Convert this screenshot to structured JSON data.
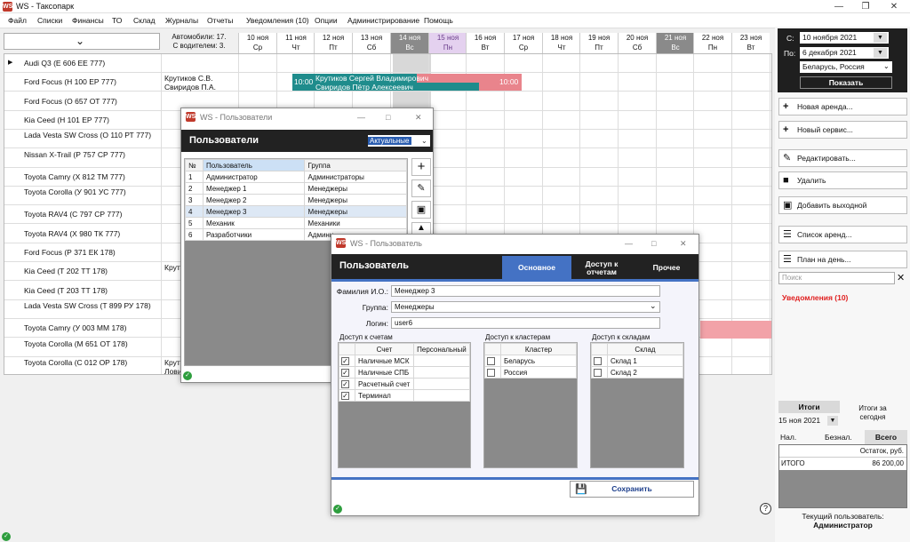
{
  "app": {
    "title": "WS - Таксопарк",
    "icon": "WS"
  },
  "menu": [
    "Файл",
    "Списки",
    "Финансы",
    "ТО",
    "Склад",
    "Журналы",
    "Отчеты",
    "Уведомления (10)",
    "Опции",
    "Администрирование",
    "Помощь"
  ],
  "header": {
    "cars_line1": "Автомобили: 17.",
    "cars_line2": "С водителем: 3."
  },
  "days": [
    {
      "d": "10 ноя",
      "w": "Ср"
    },
    {
      "d": "11 ноя",
      "w": "Чт"
    },
    {
      "d": "12 ноя",
      "w": "Пт"
    },
    {
      "d": "13 ноя",
      "w": "Сб"
    },
    {
      "d": "14 ноя",
      "w": "Вс"
    },
    {
      "d": "15 ноя",
      "w": "Пн"
    },
    {
      "d": "16 ноя",
      "w": "Вт"
    },
    {
      "d": "17 ноя",
      "w": "Ср"
    },
    {
      "d": "18 ноя",
      "w": "Чт"
    },
    {
      "d": "19 ноя",
      "w": "Пт"
    },
    {
      "d": "20 ноя",
      "w": "Сб"
    },
    {
      "d": "21 ноя",
      "w": "Вс"
    },
    {
      "d": "22 ноя",
      "w": "Пн"
    },
    {
      "d": "23 ноя",
      "w": "Вт"
    }
  ],
  "cars": [
    {
      "name": "Audi Q3 (Е 606 ЕЕ 777)",
      "drv": ""
    },
    {
      "name": "Ford Focus (Н 100 ЕР 777)",
      "drv": "Крутиков С.В.\nСвиридов П.А."
    },
    {
      "name": "Ford Focus (О 657 ОТ 777)",
      "drv": ""
    },
    {
      "name": "Kia Ceed (Н 101 ЕР 777)",
      "drv": ""
    },
    {
      "name": "Lada Vesta SW Cross (О 110 РТ 777)",
      "drv": ""
    },
    {
      "name": "Nissan X-Trail (Р 757 СР 777)",
      "drv": ""
    },
    {
      "name": "Toyota Camry (Х 812 ТМ 777)",
      "drv": ""
    },
    {
      "name": "Toyota Corolla (У 901 УС 777)",
      "drv": ""
    },
    {
      "name": "Toyota RAV4 (С 797 СР 777)",
      "drv": ""
    },
    {
      "name": "Toyota RAV4 (Х 980 ТК 777)",
      "drv": ""
    },
    {
      "name": "Ford Focus (Р 371 ЕК 178)",
      "drv": ""
    },
    {
      "name": "Kia Ceed (Т 202 ТТ 178)",
      "drv": "Крут"
    },
    {
      "name": "Kia Ceed (Т 203 ТТ 178)",
      "drv": ""
    },
    {
      "name": "Lada Vesta SW Cross (Т 899 РУ 178)",
      "drv": ""
    },
    {
      "name": "Toyota Camry (У 003 ММ 178)",
      "drv": ""
    },
    {
      "name": "Toyota Corolla (М 651 ОТ 178)",
      "drv": ""
    },
    {
      "name": "Toyota Corolla (С 012 ОР 178)",
      "drv": "Крут\nЛови"
    }
  ],
  "rental": {
    "start": "10:00",
    "end": "10:00",
    "line1": "Крутиков Сергей Владимирович",
    "line2": "Свиридов Пётр Алексеевич"
  },
  "filter": {
    "from_label": "С:",
    "from": "10 ноября  2021",
    "to_label": "По:",
    "to": "6 декабря  2021",
    "region": "Беларусь, Россия",
    "show": "Показать"
  },
  "actions": [
    "Новая аренда...",
    "Новый сервис...",
    "Редактировать...",
    "Удалить",
    "Добавить выходной",
    "Список аренд...",
    "План на день..."
  ],
  "search_placeholder": "Поиск",
  "notifications": "Уведомления (10)",
  "totals": {
    "title": "Итоги",
    "date": "15 ноя  2021",
    "today": "Итоги за\nсегодня",
    "tabs": [
      "Нал.",
      "Безнал.",
      "Всего"
    ],
    "col": "Остаток, руб.",
    "row_label": "ИТОГО",
    "row_value": "86 200,00"
  },
  "current_user": {
    "label": "Текущий пользователь:",
    "name": "Администратор"
  },
  "users_window": {
    "title": "WS - Пользователи",
    "heading": "Пользователи",
    "filter": "Актуальные",
    "cols": [
      "№",
      "Пользователь",
      "Группа"
    ],
    "rows": [
      [
        "1",
        "Администратор",
        "Администраторы"
      ],
      [
        "2",
        "Менеджер 1",
        "Менеджеры"
      ],
      [
        "3",
        "Менеджер 2",
        "Менеджеры"
      ],
      [
        "4",
        "Менеджер 3",
        "Менеджеры"
      ],
      [
        "5",
        "Механик",
        "Механики"
      ],
      [
        "6",
        "Разработчики",
        "Админи"
      ]
    ]
  },
  "user_window": {
    "title": "WS - Пользователь",
    "heading": "Пользователь",
    "tabs": [
      "Основное",
      "Доступ к отчетам",
      "Прочее"
    ],
    "fio_label": "Фамилия И.О.:",
    "fio": "Менеджер 3",
    "group_label": "Группа:",
    "group": "Менеджеры",
    "login_label": "Логин:",
    "login": "user6",
    "accounts": {
      "title": "Доступ к счетам",
      "cols": [
        "Счет",
        "Персональный"
      ],
      "rows": [
        "Наличные МСК",
        "Наличные СПБ",
        "Расчетный счет",
        "Терминал"
      ]
    },
    "clusters": {
      "title": "Доступ к кластерам",
      "col": "Кластер",
      "rows": [
        "Беларусь",
        "Россия"
      ]
    },
    "stores": {
      "title": "Доступ к складам",
      "col": "Склад",
      "rows": [
        "Склад 1",
        "Склад 2"
      ]
    },
    "save": "Сохранить"
  },
  "colors": {
    "dark": "#222222",
    "accent": "#4472c4",
    "rental": "#1f8c8c",
    "rental_tail": "#e9848c",
    "notif": "#e02020"
  }
}
